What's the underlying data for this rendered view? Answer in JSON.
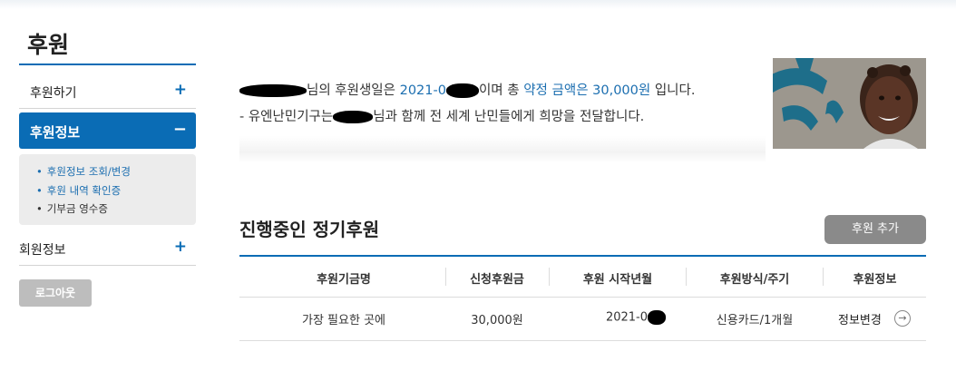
{
  "sidebar": {
    "title": "후원",
    "items": [
      {
        "label": "후원하기",
        "toggle": "+"
      },
      {
        "label": "후원정보",
        "toggle": "−"
      },
      {
        "label": "회원정보",
        "toggle": "+"
      }
    ],
    "submenu": [
      "후원정보 조회/변경",
      "후원 내역 확인증",
      "기부금 영수증"
    ],
    "logout_label": "로그아웃"
  },
  "info": {
    "line1": {
      "prefix": "님의 후원생일은 ",
      "date": "2021-0",
      "mid": "이며 총 ",
      "amount_label": "약정 금액은 30,000원",
      "suffix": " 입니다."
    },
    "line2": {
      "bullet": "-",
      "prefix": " 유엔난민기구는",
      "suffix": "님과 함께 전 세계 난민들에게 희망을 전달합니다."
    }
  },
  "section": {
    "title": "진행중인 정기후원",
    "add_button": "후원 추가"
  },
  "table": {
    "headers": [
      "후원기금명",
      "신청후원금",
      "후원 시작년월",
      "후원방식/주기",
      "후원정보"
    ],
    "rows": [
      {
        "fund": "가장 필요한 곳에",
        "amount": "30,000원",
        "start": "2021-0",
        "method": "신용카드/1개월",
        "action": "정보변경"
      }
    ]
  },
  "colors": {
    "accent": "#0a6cb5",
    "link": "#1b6eb0",
    "button_gray": "#8a8a8a",
    "logout_gray": "#bdbdbd"
  },
  "icons": [
    "plus-icon",
    "minus-icon",
    "arrow-right-circle-icon"
  ]
}
